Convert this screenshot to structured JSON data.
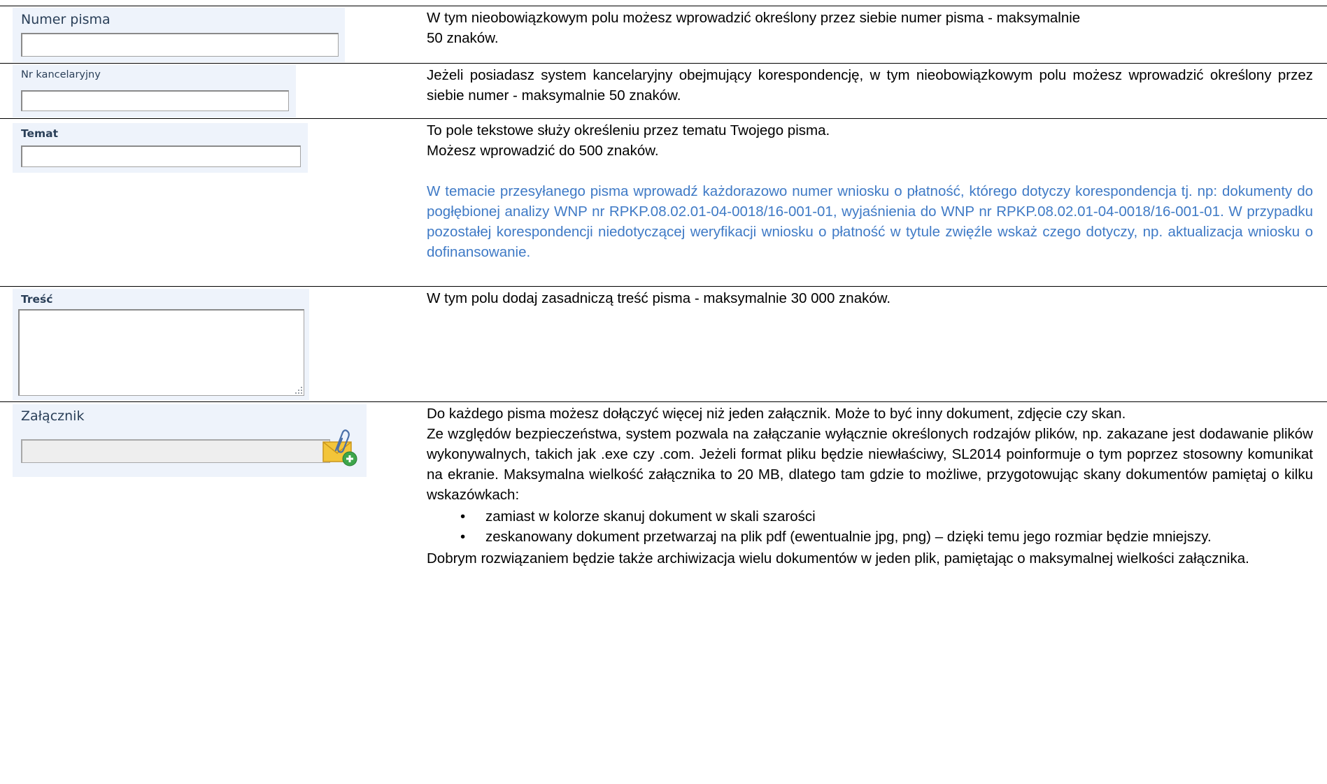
{
  "rows": [
    {
      "label": "Numer pisma",
      "description": "W tym nieobowiązkowym polu możesz wprowadzić określony przez siebie numer pisma - maksymalnie",
      "description_2": "50 znaków."
    },
    {
      "label": "Nr kancelaryjny",
      "description": "Jeżeli posiadasz system kancelaryjny obejmujący korespondencję, w tym nieobowiązkowym polu możesz wprowadzić określony przez siebie numer -  maksymalnie 50 znaków."
    },
    {
      "label": "Temat",
      "description": "To pole tekstowe służy określeniu przez tematu Twojego pisma.",
      "description_2": "Możesz wprowadzić do 500 znaków.",
      "note": "W temacie przesyłanego pisma wprowadź każdorazowo numer wniosku o płatność, którego dotyczy korespondencja tj. np: dokumenty do pogłębionej analizy WNP nr RPKP.08.02.01-04-0018/16-001-01, wyjaśnienia do WNP nr RPKP.08.02.01-04-0018/16-001-01. W przypadku pozostałej korespondencji niedotyczącej weryfikacji wniosku o płatność w tytule zwięźle wskaż czego dotyczy, np. aktualizacja wniosku o dofinansowanie."
    },
    {
      "label": "Treść",
      "description": "W tym polu dodaj zasadniczą treść pisma - maksymalnie 30 000 znaków."
    },
    {
      "label": "Załącznik",
      "icon": "attachment-add-icon",
      "paragraphs": [
        "Do każdego pisma możesz dołączyć więcej niż jeden załącznik. Może to być inny dokument, zdjęcie czy skan.",
        "Ze względów bezpieczeństwa, system pozwala na  załączanie wyłącznie określonych rodzajów plików, np. zakazane jest dodawanie plików wykonywalnych, takich jak .exe czy .com. Jeżeli format pliku będzie niewłaściwy, SL2014 poinformuje o tym poprzez stosowny komunikat na ekranie. Maksymalna wielkość załącznika to 20 MB, dlatego tam gdzie to możliwe, przygotowując skany dokumentów pamiętaj o kilku wskazówkach:"
      ],
      "bullets": [
        "zamiast w kolorze skanuj dokument w skali szarości",
        "zeskanowany dokument przetwarzaj na plik pdf (ewentualnie jpg, png) – dzięki temu jego rozmiar będzie mniejszy."
      ],
      "closing": "Dobrym rozwiązaniem będzie także archiwizacja wielu dokumentów w jeden plik, pamiętając o maksymalnej wielkości załącznika."
    }
  ],
  "colors": {
    "note_text": "#3f7ac6",
    "panel_bg": "#eef3fb",
    "label_text": "#2a3f58"
  }
}
